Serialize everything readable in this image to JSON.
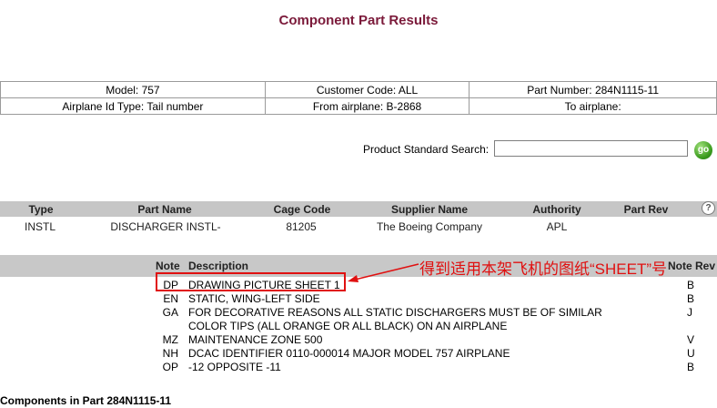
{
  "page": {
    "title": "Component Part Results"
  },
  "info": {
    "model": "Model: 757",
    "customer_code": "Customer Code: ALL",
    "part_number": "Part Number: 284N1115-11",
    "airplane_id_type": "Airplane Id Type: Tail number",
    "from_airplane": "From airplane: B-2868",
    "to_airplane": "To airplane:"
  },
  "search": {
    "label": "Product Standard Search:",
    "value": "",
    "go_label": "go"
  },
  "parts_table": {
    "headers": {
      "type": "Type",
      "part_name": "Part Name",
      "cage_code": "Cage Code",
      "supplier_name": "Supplier Name",
      "authority": "Authority",
      "part_rev": "Part Rev"
    },
    "help": "?",
    "row": {
      "type": "INSTL",
      "part_name": "DISCHARGER INSTL-",
      "cage_code": "81205",
      "supplier_name": "The Boeing Company",
      "authority": "APL",
      "part_rev": ""
    }
  },
  "notes": {
    "headers": {
      "note": "Note",
      "description": "Description",
      "rev": "Note Rev"
    },
    "items": [
      {
        "code": "DP",
        "desc": "DRAWING PICTURE SHEET 1",
        "rev": "B"
      },
      {
        "code": "EN",
        "desc": "STATIC, WING-LEFT SIDE",
        "rev": "B"
      },
      {
        "code": "GA",
        "desc": "FOR DECORATIVE REASONS ALL STATIC DISCHARGERS MUST BE OF SIMILAR COLOR TIPS (ALL ORANGE OR ALL BLACK) ON AN AIRPLANE",
        "rev": "J"
      },
      {
        "code": "MZ",
        "desc": "MAINTENANCE ZONE 500",
        "rev": "V"
      },
      {
        "code": "NH",
        "desc": "DCAC IDENTIFIER 0110-000014 MAJOR MODEL 757 AIRPLANE",
        "rev": "U"
      },
      {
        "code": "OP",
        "desc": "-12 OPPOSITE -11",
        "rev": "B"
      }
    ]
  },
  "annotation": {
    "text": "得到适用本架飞机的图纸“SHEET”号",
    "color": "#e01010"
  },
  "components": {
    "title": "Components in Part 284N1115-11"
  },
  "colors": {
    "title": "#7b1a3a",
    "header_bar": "#c6c6c6",
    "go_button": "#3a9a1d",
    "annotation": "#e01010"
  }
}
